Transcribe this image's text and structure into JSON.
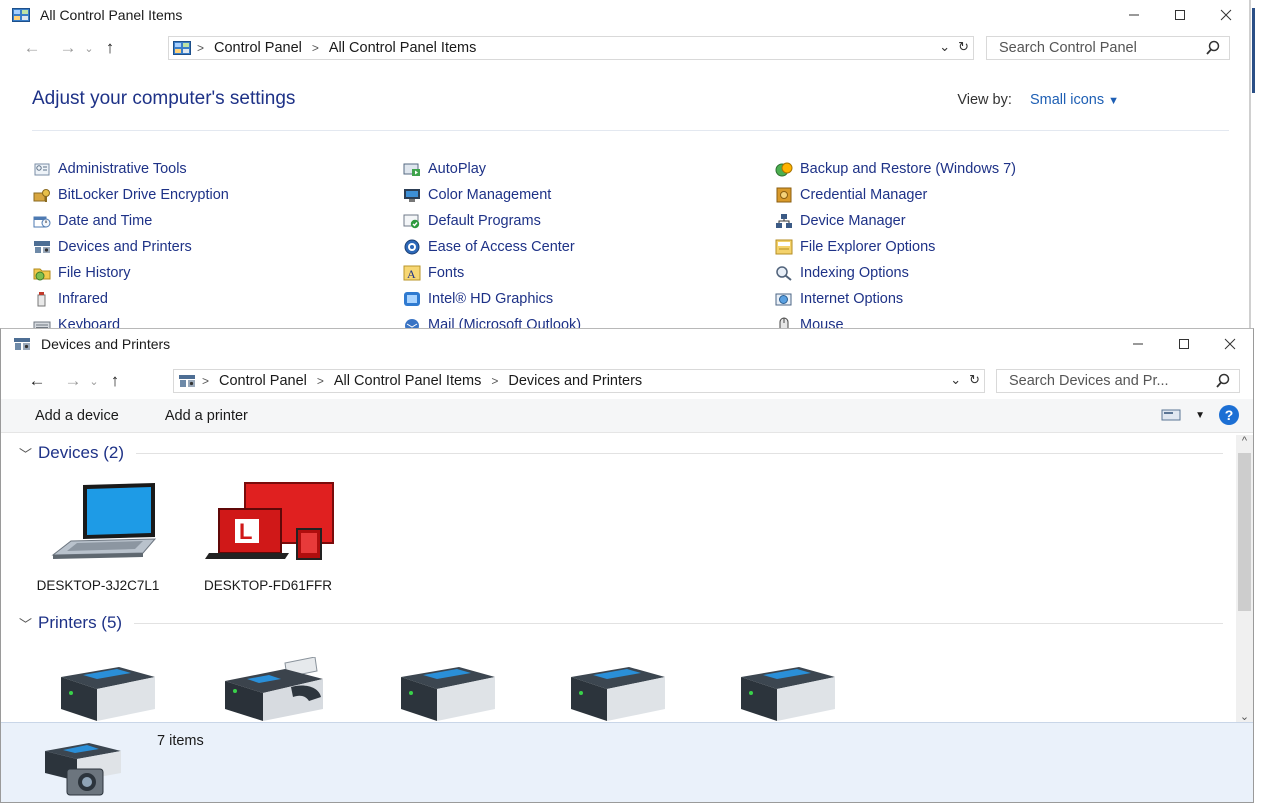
{
  "control_panel": {
    "title": "All Control Panel Items",
    "breadcrumb": [
      "Control Panel",
      "All Control Panel Items"
    ],
    "search_placeholder": "Search Control Panel",
    "heading": "Adjust your computer's settings",
    "view_by_label": "View by:",
    "view_by_value": "Small icons",
    "items": [
      {
        "label": "Administrative Tools",
        "icon": "admin-tools-icon"
      },
      {
        "label": "BitLocker Drive Encryption",
        "icon": "bitlocker-icon"
      },
      {
        "label": "Date and Time",
        "icon": "date-time-icon"
      },
      {
        "label": "Devices and Printers",
        "icon": "devices-printers-icon"
      },
      {
        "label": "File History",
        "icon": "file-history-icon"
      },
      {
        "label": "Infrared",
        "icon": "infrared-icon"
      },
      {
        "label": "Keyboard",
        "icon": "keyboard-icon"
      },
      {
        "label": "AutoPlay",
        "icon": "autoplay-icon"
      },
      {
        "label": "Color Management",
        "icon": "color-management-icon"
      },
      {
        "label": "Default Programs",
        "icon": "default-programs-icon"
      },
      {
        "label": "Ease of Access Center",
        "icon": "ease-of-access-icon"
      },
      {
        "label": "Fonts",
        "icon": "fonts-icon"
      },
      {
        "label": "Intel® HD Graphics",
        "icon": "intel-graphics-icon"
      },
      {
        "label": "Mail (Microsoft Outlook)",
        "icon": "mail-icon"
      },
      {
        "label": "Backup and Restore (Windows 7)",
        "icon": "backup-restore-icon"
      },
      {
        "label": "Credential Manager",
        "icon": "credential-manager-icon"
      },
      {
        "label": "Device Manager",
        "icon": "device-manager-icon"
      },
      {
        "label": "File Explorer Options",
        "icon": "file-explorer-options-icon"
      },
      {
        "label": "Indexing Options",
        "icon": "indexing-options-icon"
      },
      {
        "label": "Internet Options",
        "icon": "internet-options-icon"
      },
      {
        "label": "Mouse",
        "icon": "mouse-icon"
      }
    ]
  },
  "devices_printers": {
    "title": "Devices and Printers",
    "breadcrumb": [
      "Control Panel",
      "All Control Panel Items",
      "Devices and Printers"
    ],
    "search_placeholder": "Search Devices and Pr...",
    "commands": {
      "add_device": "Add a device",
      "add_printer": "Add a printer"
    },
    "groups": {
      "devices": "Devices (2)",
      "printers": "Printers (5)"
    },
    "devices": [
      {
        "label": "DESKTOP-3J2C7L1",
        "icon": "laptop-icon"
      },
      {
        "label": "DESKTOP-FD61FFR",
        "icon": "computer-red-icon"
      }
    ],
    "printers": [
      {
        "icon": "printer-icon"
      },
      {
        "icon": "fax-icon"
      },
      {
        "icon": "printer-icon"
      },
      {
        "icon": "printer-icon"
      },
      {
        "icon": "printer-icon"
      }
    ],
    "status": "7 items"
  },
  "colors": {
    "link": "#1e3287",
    "accent": "#1c6fd4",
    "details_bg": "#eaf1fa"
  }
}
